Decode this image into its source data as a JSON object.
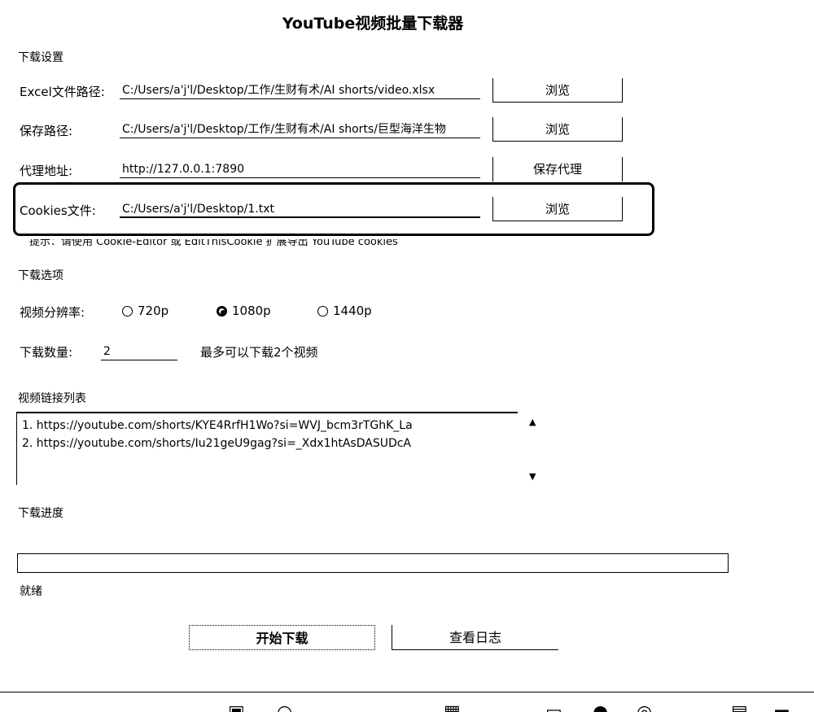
{
  "window": {
    "title": "YouTube视频批量下载器"
  },
  "download_settings": {
    "heading": "下载设置",
    "excel": {
      "label": "Excel文件路径:",
      "value": "C:/Users/a'j'l/Desktop/工作/生财有术/AI shorts/video.xlsx",
      "button": "浏览"
    },
    "save": {
      "label": "保存路径:",
      "value": "C:/Users/a'j'l/Desktop/工作/生财有术/AI shorts/巨型海洋生物",
      "button": "浏览"
    },
    "proxy": {
      "label": "代理地址:",
      "value": "http://127.0.0.1:7890",
      "button": "保存代理"
    },
    "cookies": {
      "label": "Cookies文件:",
      "value": "C:/Users/a'j'l/Desktop/1.txt",
      "button": "浏览"
    },
    "hint": "提示：请使用 Cookie-Editor 或 EditThisCookie 扩展导出 YouTube cookies"
  },
  "download_options": {
    "heading": "下载选项",
    "resolution_label": "视频分辨率:",
    "resolutions": [
      {
        "label": "720p",
        "selected": false
      },
      {
        "label": "1080p",
        "selected": true
      },
      {
        "label": "1440p",
        "selected": false
      }
    ],
    "count_label": "下载数量:",
    "count_value": "2",
    "count_note": "最多可以下载2个视频"
  },
  "link_list": {
    "heading": "视频链接列表",
    "items": [
      "1. https://youtube.com/shorts/KYE4RrfH1Wo?si=WVJ_bcm3rTGhK_La",
      "2. https://youtube.com/shorts/Iu21geU9gag?si=_Xdx1htAsDASUDcA"
    ],
    "scroll_up_icon": "triangle-up-icon",
    "scroll_down_icon": "triangle-down-icon"
  },
  "progress": {
    "heading": "下载进度",
    "percent": 0,
    "status": "就绪"
  },
  "actions": {
    "start": "开始下载",
    "view_log": "查看日志"
  }
}
